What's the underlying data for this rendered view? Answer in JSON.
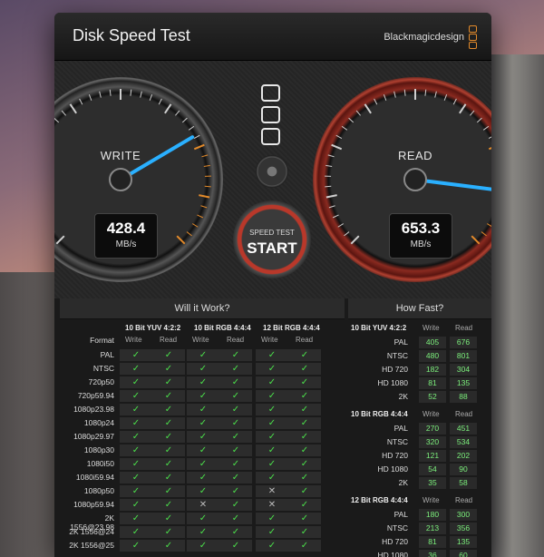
{
  "window": {
    "title": "Disk Speed Test",
    "brand": "Blackmagicdesign"
  },
  "gauges": {
    "write": {
      "label": "WRITE",
      "value": "428.4",
      "unit": "MB/s",
      "needle_fraction": 0.72
    },
    "read": {
      "label": "READ",
      "value": "653.3",
      "unit": "MB/s",
      "needle_fraction": 0.86
    }
  },
  "start": {
    "caption": "SPEED TEST",
    "label": "START"
  },
  "will_it_work": {
    "title": "Will it Work?",
    "format_header": "Format",
    "groups": [
      {
        "name": "10 Bit YUV 4:2:2",
        "write": "Write",
        "read": "Read"
      },
      {
        "name": "10 Bit RGB 4:4:4",
        "write": "Write",
        "read": "Read"
      },
      {
        "name": "12 Bit RGB 4:4:4",
        "write": "Write",
        "read": "Read"
      }
    ],
    "rows": [
      {
        "format": "PAL",
        "cells": [
          "ok",
          "ok",
          "ok",
          "ok",
          "ok",
          "ok"
        ]
      },
      {
        "format": "NTSC",
        "cells": [
          "ok",
          "ok",
          "ok",
          "ok",
          "ok",
          "ok"
        ]
      },
      {
        "format": "720p50",
        "cells": [
          "ok",
          "ok",
          "ok",
          "ok",
          "ok",
          "ok"
        ]
      },
      {
        "format": "720p59.94",
        "cells": [
          "ok",
          "ok",
          "ok",
          "ok",
          "ok",
          "ok"
        ]
      },
      {
        "format": "1080p23.98",
        "cells": [
          "ok",
          "ok",
          "ok",
          "ok",
          "ok",
          "ok"
        ]
      },
      {
        "format": "1080p24",
        "cells": [
          "ok",
          "ok",
          "ok",
          "ok",
          "ok",
          "ok"
        ]
      },
      {
        "format": "1080p29.97",
        "cells": [
          "ok",
          "ok",
          "ok",
          "ok",
          "ok",
          "ok"
        ]
      },
      {
        "format": "1080p30",
        "cells": [
          "ok",
          "ok",
          "ok",
          "ok",
          "ok",
          "ok"
        ]
      },
      {
        "format": "1080i50",
        "cells": [
          "ok",
          "ok",
          "ok",
          "ok",
          "ok",
          "ok"
        ]
      },
      {
        "format": "1080i59.94",
        "cells": [
          "ok",
          "ok",
          "ok",
          "ok",
          "ok",
          "ok"
        ]
      },
      {
        "format": "1080p50",
        "cells": [
          "ok",
          "ok",
          "ok",
          "ok",
          "no",
          "ok"
        ]
      },
      {
        "format": "1080p59.94",
        "cells": [
          "ok",
          "ok",
          "no",
          "ok",
          "no",
          "ok"
        ]
      },
      {
        "format": "2K 1556@23.98",
        "cells": [
          "ok",
          "ok",
          "ok",
          "ok",
          "ok",
          "ok"
        ]
      },
      {
        "format": "2K 1556@24",
        "cells": [
          "ok",
          "ok",
          "ok",
          "ok",
          "ok",
          "ok"
        ]
      },
      {
        "format": "2K 1556@25",
        "cells": [
          "ok",
          "ok",
          "ok",
          "ok",
          "ok",
          "ok"
        ]
      }
    ],
    "symbols": {
      "ok": "✓",
      "no": "✕"
    }
  },
  "how_fast": {
    "title": "How Fast?",
    "groups": [
      {
        "name": "10 Bit YUV 4:2:2",
        "write": "Write",
        "read": "Read",
        "rows": [
          {
            "label": "PAL",
            "write": "405",
            "read": "676"
          },
          {
            "label": "NTSC",
            "write": "480",
            "read": "801"
          },
          {
            "label": "HD 720",
            "write": "182",
            "read": "304"
          },
          {
            "label": "HD 1080",
            "write": "81",
            "read": "135"
          },
          {
            "label": "2K",
            "write": "52",
            "read": "88"
          }
        ]
      },
      {
        "name": "10 Bit RGB 4:4:4",
        "write": "Write",
        "read": "Read",
        "rows": [
          {
            "label": "PAL",
            "write": "270",
            "read": "451"
          },
          {
            "label": "NTSC",
            "write": "320",
            "read": "534"
          },
          {
            "label": "HD 720",
            "write": "121",
            "read": "202"
          },
          {
            "label": "HD 1080",
            "write": "54",
            "read": "90"
          },
          {
            "label": "2K",
            "write": "35",
            "read": "58"
          }
        ]
      },
      {
        "name": "12 Bit RGB 4:4:4",
        "write": "Write",
        "read": "Read",
        "rows": [
          {
            "label": "PAL",
            "write": "180",
            "read": "300"
          },
          {
            "label": "NTSC",
            "write": "213",
            "read": "356"
          },
          {
            "label": "HD 720",
            "write": "81",
            "read": "135"
          },
          {
            "label": "HD 1080",
            "write": "36",
            "read": "60"
          },
          {
            "label": "2K",
            "write": "23",
            "read": "39"
          }
        ]
      }
    ]
  },
  "colors": {
    "accent_orange": "#e38a2a",
    "needle": "#2ab0ff",
    "ok_green": "#4be04b",
    "read_ring": "#b04030"
  }
}
